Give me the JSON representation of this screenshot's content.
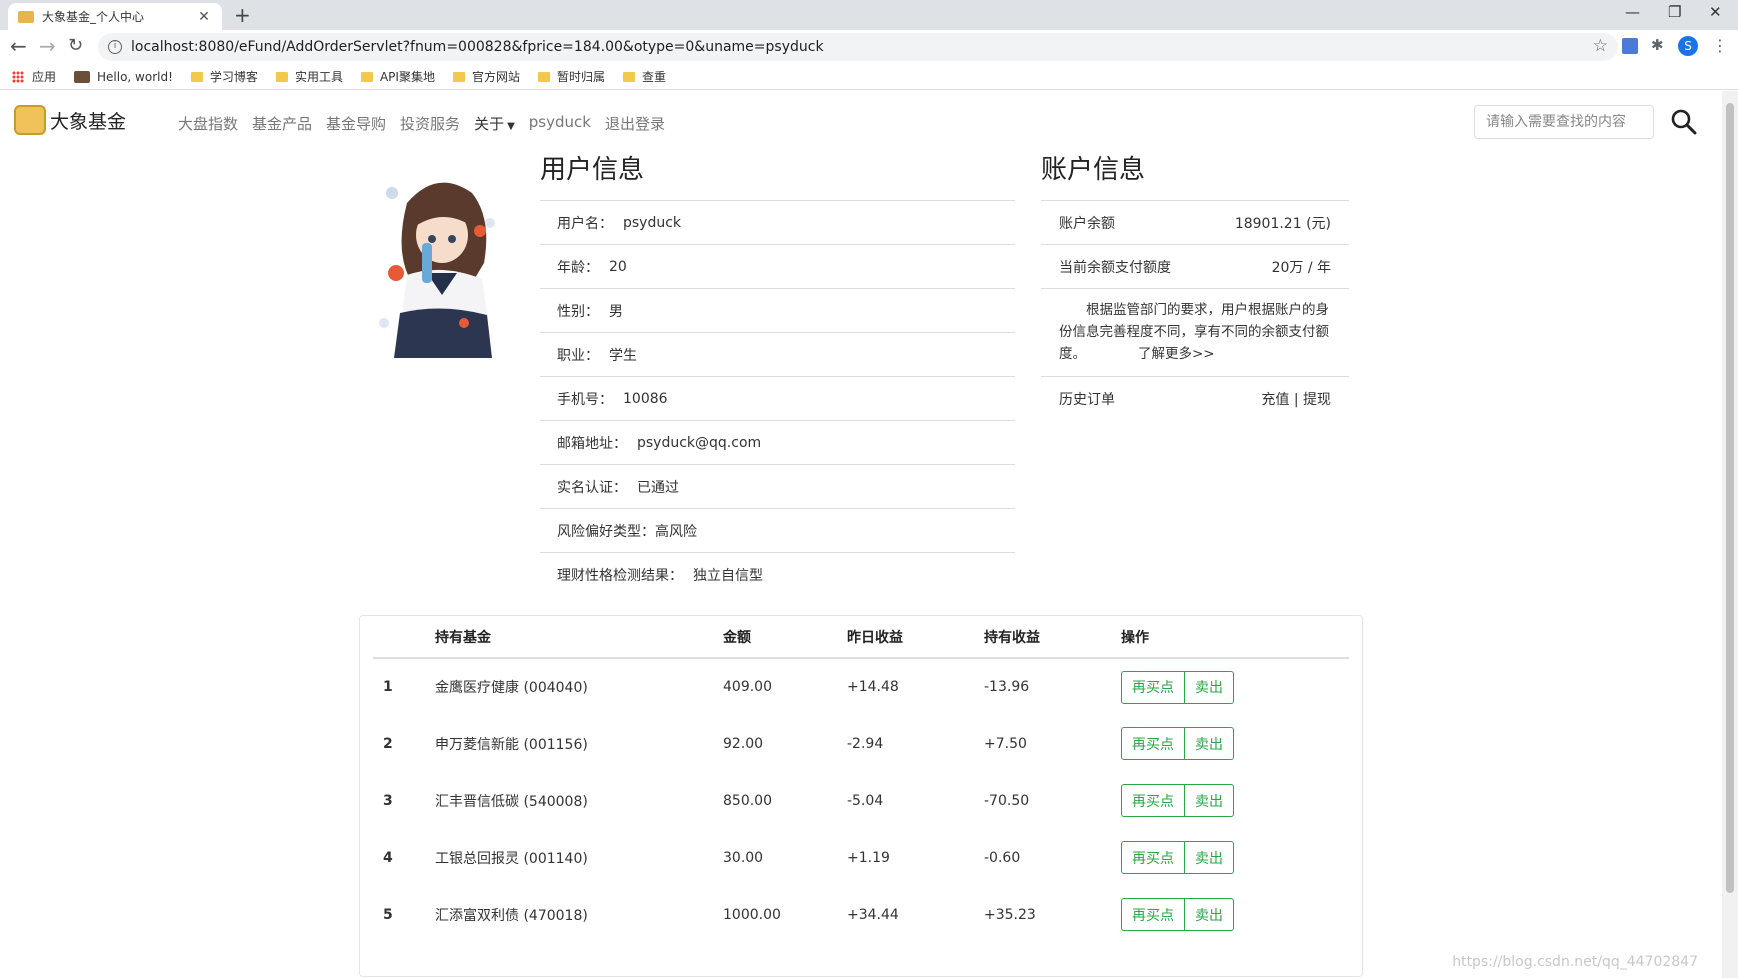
{
  "browser": {
    "tab_title": "大象基金_个人中心",
    "url": "localhost:8080/eFund/AddOrderServlet?fnum=000828&fprice=184.00&otype=0&uname=psyduck",
    "profile_initial": "S",
    "bookmarks": [
      {
        "label": "应用",
        "icon": "apps-icon"
      },
      {
        "label": "Hello, world!",
        "icon": "site-icon"
      },
      {
        "label": "学习博客",
        "icon": "folder-icon"
      },
      {
        "label": "实用工具",
        "icon": "folder-icon"
      },
      {
        "label": "API聚集地",
        "icon": "folder-icon"
      },
      {
        "label": "官方网站",
        "icon": "folder-icon"
      },
      {
        "label": "暂时归属",
        "icon": "folder-icon"
      },
      {
        "label": "查重",
        "icon": "folder-icon"
      }
    ]
  },
  "site": {
    "brand": "大象基金",
    "nav": [
      "大盘指数",
      "基金产品",
      "基金导购",
      "投资服务"
    ],
    "about": "关于",
    "username": "psyduck",
    "logout": "退出登录",
    "search_placeholder": "请输入需要查找的内容"
  },
  "user_info": {
    "title": "用户信息",
    "rows": [
      {
        "label": "用户名：",
        "value": "psyduck"
      },
      {
        "label": "年龄：",
        "value": "20"
      },
      {
        "label": "性别：",
        "value": "男"
      },
      {
        "label": "职业：",
        "value": "学生"
      },
      {
        "label": "手机号：",
        "value": "10086"
      },
      {
        "label": "邮箱地址：",
        "value": "psyduck@qq.com"
      },
      {
        "label": "实名认证：",
        "value": "已通过"
      },
      {
        "label": "风险偏好类型：",
        "value": "高风险"
      },
      {
        "label": "理财性格检测结果：",
        "value": "独立自信型"
      }
    ]
  },
  "account_info": {
    "title": "账户信息",
    "balance_label": "账户余额",
    "balance_value": "18901.21 (元)",
    "limit_label": "当前余额支付额度",
    "limit_value": "20万 / 年",
    "note": "根据监管部门的要求，用户根据账户的身份信息完善程度不同，享有不同的余额支付额度。",
    "learn_more": "了解更多>>",
    "history_label": "历史订单",
    "recharge": "充值",
    "separator": "|",
    "withdraw": "提现"
  },
  "holdings": {
    "headers": [
      "",
      "持有基金",
      "金额",
      "昨日收益",
      "持有收益",
      "操作"
    ],
    "buy_label": "再买点",
    "sell_label": "卖出",
    "rows": [
      {
        "idx": "1",
        "fund": "金鹰医疗健康 (004040)",
        "amount": "409.00",
        "yesterday": "+14.48",
        "holding": "-13.96"
      },
      {
        "idx": "2",
        "fund": "申万菱信新能 (001156)",
        "amount": "92.00",
        "yesterday": "-2.94",
        "holding": "+7.50"
      },
      {
        "idx": "3",
        "fund": "汇丰晋信低碳 (540008)",
        "amount": "850.00",
        "yesterday": "-5.04",
        "holding": "-70.50"
      },
      {
        "idx": "4",
        "fund": "工银总回报灵 (001140)",
        "amount": "30.00",
        "yesterday": "+1.19",
        "holding": "-0.60"
      },
      {
        "idx": "5",
        "fund": "汇添富双利债 (470018)",
        "amount": "1000.00",
        "yesterday": "+34.44",
        "holding": "+35.23"
      }
    ]
  },
  "watermark": "https://blog.csdn.net/qq_44702847"
}
